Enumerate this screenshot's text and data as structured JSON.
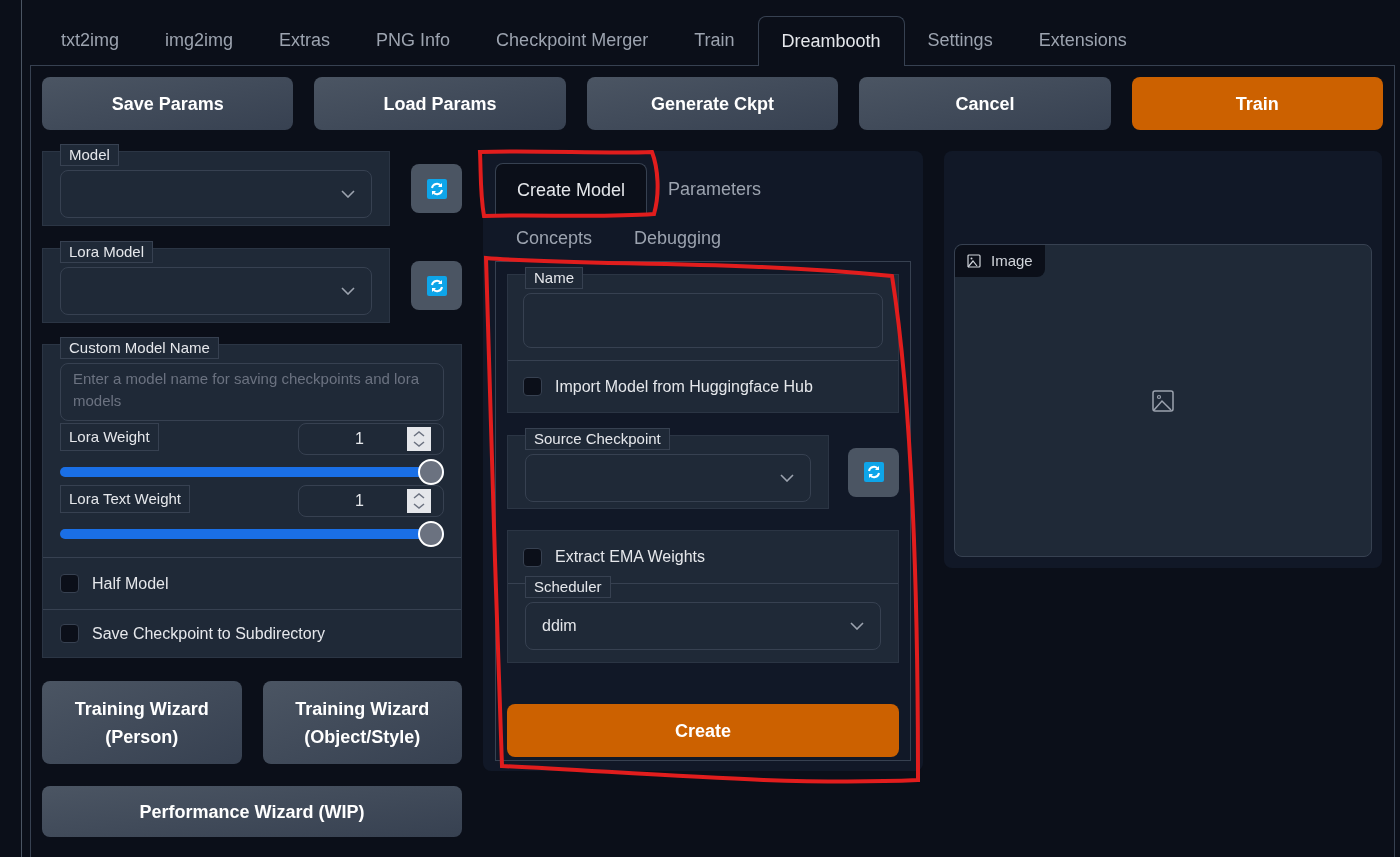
{
  "tabs": [
    {
      "label": "txt2img",
      "selected": false
    },
    {
      "label": "img2img",
      "selected": false
    },
    {
      "label": "Extras",
      "selected": false
    },
    {
      "label": "PNG Info",
      "selected": false
    },
    {
      "label": "Checkpoint Merger",
      "selected": false
    },
    {
      "label": "Train",
      "selected": false
    },
    {
      "label": "Dreambooth",
      "selected": true
    },
    {
      "label": "Settings",
      "selected": false
    },
    {
      "label": "Extensions",
      "selected": false
    }
  ],
  "toolbar": [
    {
      "label": "Save Params",
      "kind": "secondary"
    },
    {
      "label": "Load Params",
      "kind": "secondary"
    },
    {
      "label": "Generate Ckpt",
      "kind": "secondary"
    },
    {
      "label": "Cancel",
      "kind": "secondary"
    },
    {
      "label": "Train",
      "kind": "primary"
    }
  ],
  "left_panel": {
    "model": {
      "label": "Model"
    },
    "lora_model": {
      "label": "Lora Model"
    },
    "custom_model_name": {
      "label": "Custom Model Name",
      "placeholder": "Enter a model name for saving checkpoints and lora models"
    },
    "sliders": [
      {
        "label": "Lora Weight",
        "value": "1",
        "level": 1
      },
      {
        "label": "Lora Text Weight",
        "value": "1",
        "level": 1
      }
    ],
    "checkboxes": [
      {
        "label": "Half Model",
        "checked": false
      },
      {
        "label": "Save Checkpoint to Subdirectory",
        "checked": false
      }
    ],
    "wizard_buttons": [
      "Training Wizard (Person)",
      "Training Wizard (Object/Style)"
    ],
    "performance_button": "Performance Wizard (WIP)"
  },
  "create_panel": {
    "tabs": [
      {
        "label": "Create Model",
        "selected": true
      },
      {
        "label": "Parameters",
        "selected": false
      },
      {
        "label": "Concepts",
        "selected": false
      },
      {
        "label": "Debugging",
        "selected": false
      }
    ],
    "name": {
      "label": "Name"
    },
    "import_checkbox": {
      "label": "Import Model from Huggingface Hub",
      "checked": false
    },
    "source_checkpoint": {
      "label": "Source Checkpoint"
    },
    "extract_ema": {
      "label": "Extract EMA Weights",
      "checked": false
    },
    "scheduler": {
      "label": "Scheduler",
      "value": "ddim"
    },
    "create_button": "Create"
  },
  "output": {
    "image_label": "Image"
  }
}
